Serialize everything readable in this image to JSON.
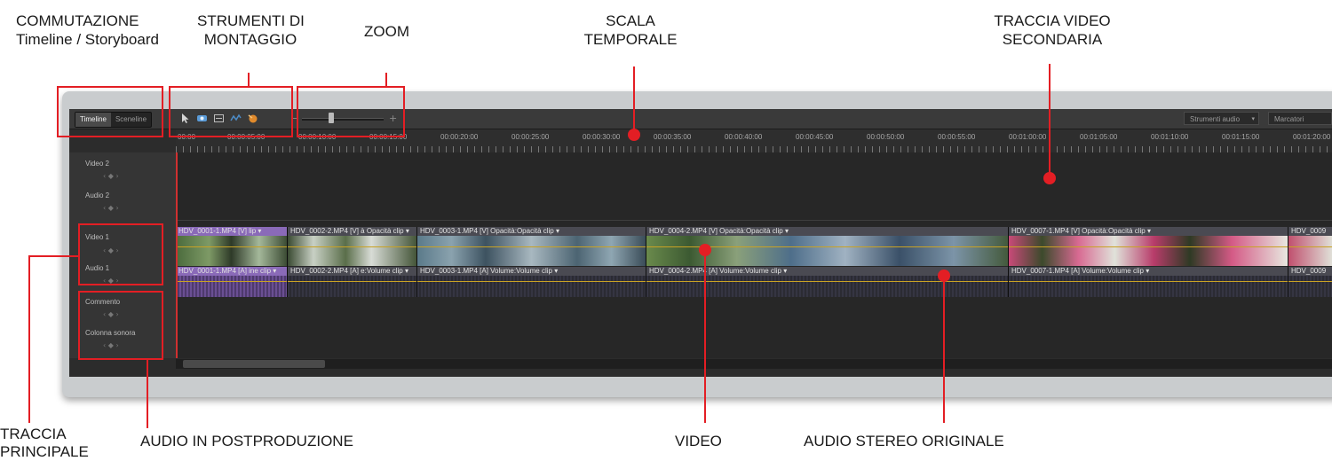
{
  "annotations": {
    "switch_line1": "COMMUTAZIONE",
    "switch_line2": "Timeline / Storyboard",
    "tools_line1": "STRUMENTI DI",
    "tools_line2": "MONTAGGIO",
    "zoom": "ZOOM",
    "scale_line1": "SCALA",
    "scale_line2": "TEMPORALE",
    "secondary_line1": "TRACCIA VIDEO",
    "secondary_line2": "SECONDARIA",
    "main_line1": "TRACCIA",
    "main_line2": "PRINCIPALE",
    "postprod": "AUDIO IN POSTPRODUZIONE",
    "video": "VIDEO",
    "audio_orig": "AUDIO STEREO ORIGINALE"
  },
  "toolbar": {
    "tabs": [
      "Timeline",
      "Sceneline"
    ],
    "zoom_minus": "−",
    "zoom_plus": "+",
    "zoom_level": 0.4,
    "audio_tools": "Strumenti audio",
    "markers": "Marcatori"
  },
  "ruler": {
    "ticks": [
      "00:00",
      "00:00:05:00",
      "00:00:10:00",
      "00:00:15:00",
      "00:00:20:00",
      "00:00:25:00",
      "00:00:30:00",
      "00:00:35:00",
      "00:00:40:00",
      "00:00:45:00",
      "00:00:50:00",
      "00:00:55:00",
      "00:01:00:00",
      "00:01:05:00",
      "00:01:10:00",
      "00:01:15:00",
      "00:01:20:00"
    ]
  },
  "tracks": {
    "video2": "Video 2",
    "audio2": "Audio 2",
    "video1": "Video 1",
    "audio1": "Audio 1",
    "narration": "Commento",
    "soundtrack": "Colonna sonora",
    "control_glyphs": "‹ ◆ ›"
  },
  "clips": {
    "v1_c1": "HDV_0001-1.MP4 [V] lip ▾",
    "v1_c2": "HDV_0002-2.MP4 [V] à Opacità clip ▾",
    "v1_c3": "HDV_0003-1.MP4 [V] Opacità:Opacità clip ▾",
    "v1_c4": "HDV_0004-2.MP4 [V] Opacità:Opacità clip ▾",
    "v1_c5": "HDV_0007-1.MP4 [V] Opacità:Opacità clip ▾",
    "v1_c6": "HDV_0009",
    "a1_c1": "HDV_0001-1.MP4 [A] ine clip ▾",
    "a1_c2": "HDV_0002-2.MP4 [A] e:Volume clip ▾",
    "a1_c3": "HDV_0003-1.MP4 [A] Volume:Volume clip ▾",
    "a1_c4": "HDV_0004-2.MP4 [A] Volume:Volume clip ▾",
    "a1_c5": "HDV_0007-1.MP4 [A] Volume:Volume clip ▾",
    "a1_c6": "HDV_0009"
  },
  "colors": {
    "highlight": "#e31e24",
    "playhead": "#d03030",
    "first_clip": "#8a6ab8",
    "rubber_band": "#c9a224"
  }
}
